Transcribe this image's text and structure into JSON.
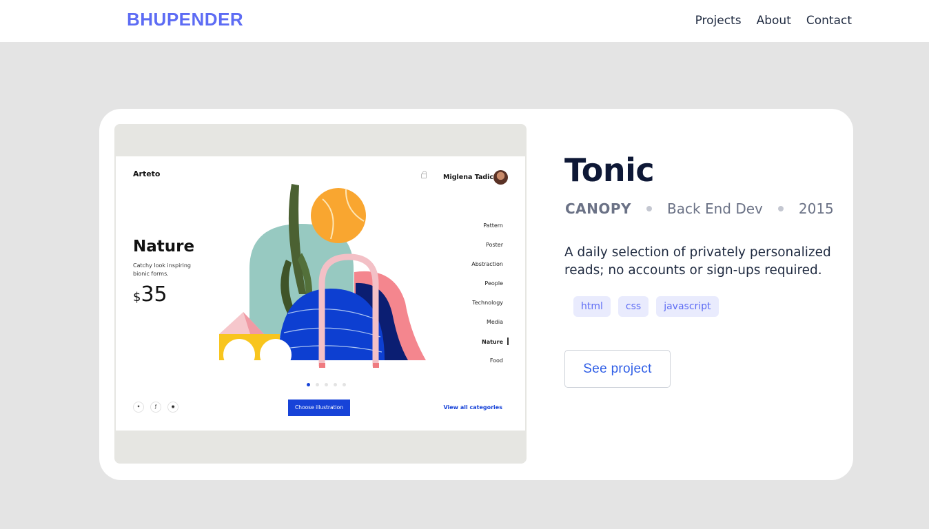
{
  "header": {
    "logo": "BHUPENDER",
    "nav": [
      "Projects",
      "About",
      "Contact"
    ]
  },
  "project": {
    "title": "Tonic",
    "client": "CANOPY",
    "role": "Back End Dev",
    "year": "2015",
    "description": "A daily selection of privately personalized reads; no accounts or sign-ups required.",
    "tags": [
      "html",
      "css",
      "javascript"
    ],
    "cta": "See project"
  },
  "preview": {
    "brand": "Arteto",
    "user": "Miglena Tadic",
    "title": "Nature",
    "subtitle": "Catchy look inspiring bionic forms.",
    "currency": "$",
    "price": "35",
    "categories": [
      "Pattern",
      "Poster",
      "Abstraction",
      "People",
      "Technology",
      "Media",
      "Nature",
      "Food"
    ],
    "active_category": "Nature",
    "socials": [
      "twitter-icon",
      "facebook-icon",
      "instagram-icon"
    ],
    "cta": "Choose illustration",
    "view_all": "View all categories"
  },
  "colors": {
    "accent": "#5d6cf4",
    "title": "#0e1836",
    "mock_blue": "#1743d8",
    "tag_bg": "#e9ebfd"
  }
}
